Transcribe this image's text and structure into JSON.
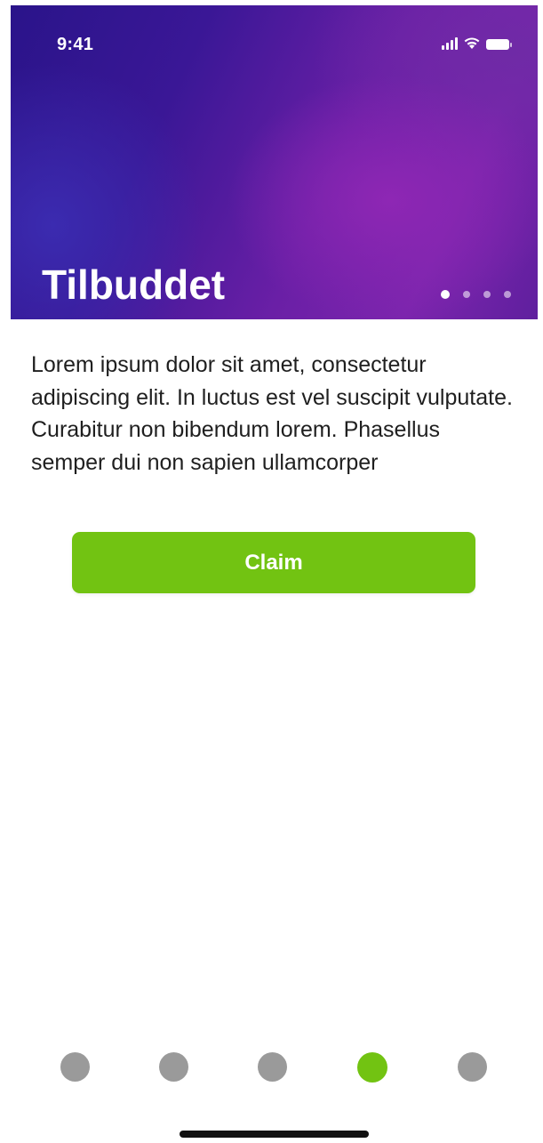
{
  "status_bar": {
    "time": "9:41",
    "icons": [
      "signal-icon",
      "wifi-icon",
      "battery-icon"
    ]
  },
  "hero": {
    "title": "Tilbuddet",
    "carousel": {
      "count": 4,
      "active_index": 0
    }
  },
  "content": {
    "body": "Lorem ipsum dolor sit amet, consectetur adipiscing elit. In luctus est vel suscipit vulputate. Curabitur non bibendum lorem. Phasellus semper dui non sapien ullamcorper",
    "claim_label": "Claim"
  },
  "page_indicator": {
    "count": 5,
    "active_index": 3
  },
  "colors": {
    "accent": "#72c312",
    "inactive_dot": "#9a9a9a",
    "hero_purple": "#7b25ad"
  }
}
